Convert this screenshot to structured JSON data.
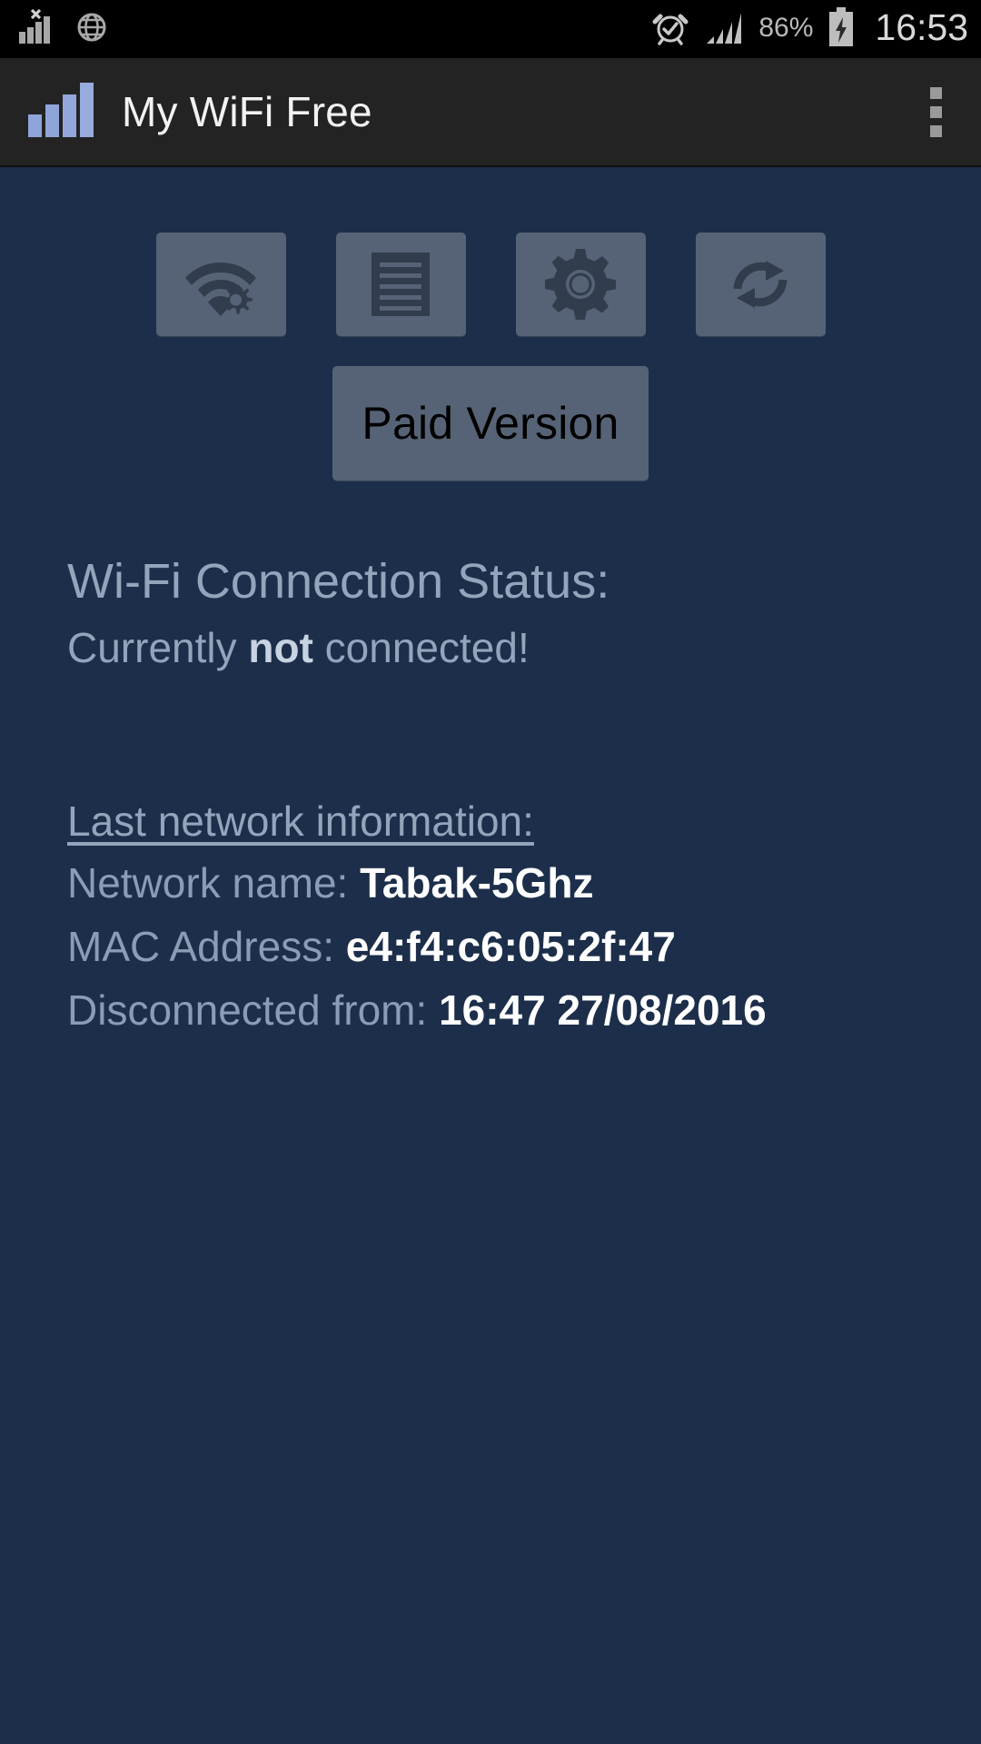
{
  "status_bar": {
    "left_icons": [
      {
        "name": "signal-no-service-icon",
        "glyph": "signal-x"
      },
      {
        "name": "globe-icon",
        "glyph": "globe"
      }
    ],
    "right_icons": [
      {
        "name": "alarm-clock-icon",
        "glyph": "alarm"
      },
      {
        "name": "cellular-signal-icon",
        "glyph": "signal"
      }
    ],
    "battery_percent": "86%",
    "battery_state": "charging",
    "clock": "16:53"
  },
  "action_bar": {
    "app_icon": "signal-bars-icon",
    "title": "My WiFi Free",
    "overflow_menu": "overflow-menu-icon"
  },
  "toolbar": {
    "buttons": [
      {
        "name": "wifi-settings-button",
        "icon": "wifi-gear-icon"
      },
      {
        "name": "network-list-button",
        "icon": "list-lines-icon"
      },
      {
        "name": "settings-button",
        "icon": "gear-icon"
      },
      {
        "name": "refresh-button",
        "icon": "refresh-sync-icon"
      }
    ],
    "paid_version_label": "Paid Version"
  },
  "wifi_status": {
    "heading": "Wi-Fi Connection Status:",
    "line_prefix": "Currently ",
    "line_emphasis": "not",
    "line_suffix": " connected!"
  },
  "last_network": {
    "heading": "Last network information:",
    "rows": [
      {
        "label": "Network name: ",
        "value": "Tabak-5Ghz"
      },
      {
        "label": "MAC Address: ",
        "value": "e4:f4:c6:05:2f:47"
      },
      {
        "label": "Disconnected from: ",
        "value": "16:47 27/08/2016"
      }
    ]
  },
  "colors": {
    "background": "#1c2e4a",
    "action_bar": "#232323",
    "status_bar": "#000000",
    "button": "#566376",
    "accent_icon": "#8fa4d8",
    "muted_text": "#8b9cb4",
    "value_text": "#ffffff"
  }
}
